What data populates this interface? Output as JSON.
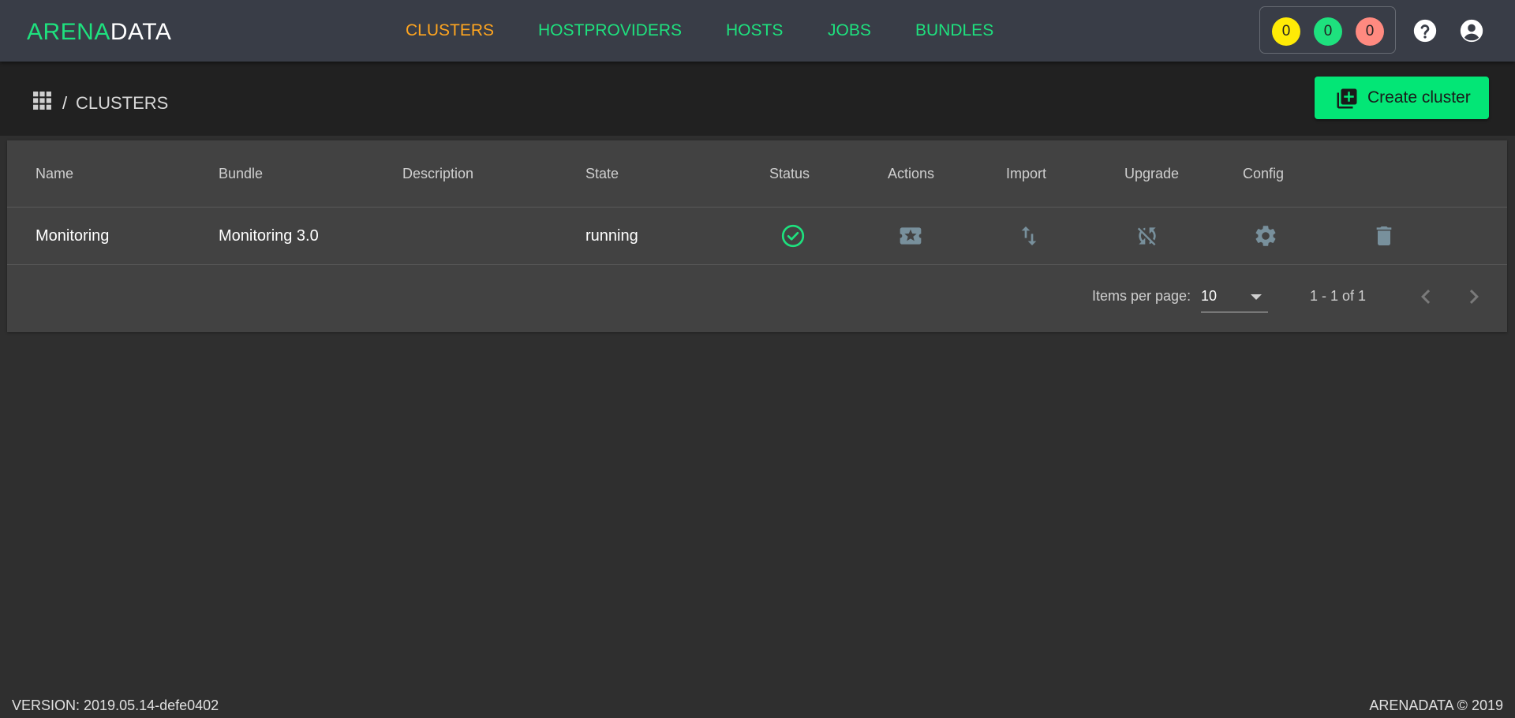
{
  "brand": {
    "part1": "ARENA",
    "part2": "DATA"
  },
  "nav": [
    {
      "label": "CLUSTERS",
      "active": true
    },
    {
      "label": "HOSTPROVIDERS",
      "active": false
    },
    {
      "label": "HOSTS",
      "active": false
    },
    {
      "label": "JOBS",
      "active": false
    },
    {
      "label": "BUNDLES",
      "active": false
    }
  ],
  "counters": {
    "yellow": "0",
    "green": "0",
    "red": "0"
  },
  "top_icons": [
    "help-icon",
    "account-icon"
  ],
  "breadcrumb": {
    "separator": "/",
    "title": "CLUSTERS"
  },
  "create_button": {
    "label": "Create cluster",
    "icon": "library-add-icon"
  },
  "table": {
    "columns": [
      "Name",
      "Bundle",
      "Description",
      "State",
      "Status",
      "Actions",
      "Import",
      "Upgrade",
      "Config"
    ],
    "rows": [
      {
        "name": "Monitoring",
        "bundle": "Monitoring 3.0",
        "description": "",
        "state": "running",
        "icons": [
          "check-circle-icon",
          "ticket-icon",
          "import-export-icon",
          "sync-disabled-icon",
          "gear-icon",
          "trash-icon"
        ]
      }
    ]
  },
  "paginator": {
    "items_per_page_label": "Items per page:",
    "items_per_page": "10",
    "range": "1 - 1 of 1"
  },
  "footer": {
    "version": "VERSION: 2019.05.14-defe0402",
    "copyright": "ARENADATA © 2019"
  },
  "colors": {
    "accent_green": "#1ee17e",
    "active_orange": "#ffa51f",
    "button_green": "#03e676",
    "icon_gray": "#78909c"
  }
}
